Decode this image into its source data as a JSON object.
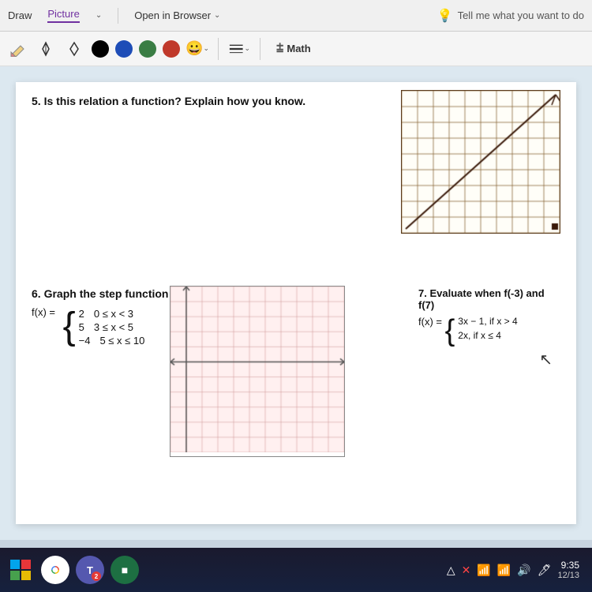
{
  "toolbar": {
    "tabs": [
      "Draw",
      "Picture"
    ],
    "active_tab": "Picture",
    "open_browser": "Open in Browser",
    "tell_me": "Tell me what you want to do",
    "math_label": "Math"
  },
  "tools": {
    "colors": [
      "#000000",
      "#1e4db7",
      "#3a7d44",
      "#c0392b"
    ],
    "color_labels": [
      "black",
      "blue",
      "green",
      "red"
    ]
  },
  "questions": {
    "q5": {
      "number": "5.",
      "text": "Is this relation a function? Explain how you know."
    },
    "q6": {
      "number": "6.",
      "text": "Graph the step function",
      "piecewise_label": "f(x) =",
      "pieces": [
        {
          "value": "2",
          "condition": "0 ≤ x < 3"
        },
        {
          "value": "5",
          "condition": "3 ≤ x < 5"
        },
        {
          "value": "-4",
          "condition": "5 ≤ x ≤ 10"
        }
      ]
    },
    "q7": {
      "number": "7.",
      "text": "Evaluate when f(-3) and f(7)",
      "piecewise_label": "f(x) =",
      "pieces": [
        {
          "expr": "3x − 1, if x > 4"
        },
        {
          "expr": "2x, if x ≤ 4"
        }
      ]
    }
  },
  "taskbar": {
    "time": "9:35",
    "date": "12/13"
  }
}
